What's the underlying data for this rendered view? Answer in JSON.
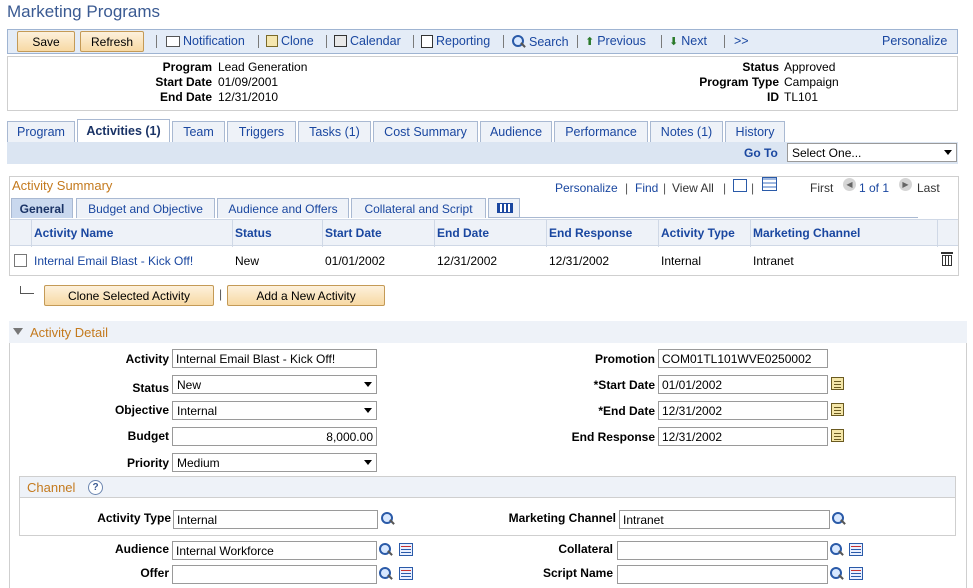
{
  "page_title": "Marketing Programs",
  "toolbar": {
    "save": "Save",
    "refresh": "Refresh",
    "notification": "Notification",
    "clone": "Clone",
    "calendar": "Calendar",
    "reporting": "Reporting",
    "search": "Search",
    "previous": "Previous",
    "next": "Next",
    "more": ">>",
    "personalize": "Personalize"
  },
  "header": {
    "program_label": "Program",
    "program": "Lead Generation",
    "start_date_label": "Start Date",
    "start_date": "01/09/2001",
    "end_date_label": "End Date",
    "end_date": "12/31/2010",
    "status_label": "Status",
    "status": "Approved",
    "program_type_label": "Program Type",
    "program_type": "Campaign",
    "id_label": "ID",
    "id": "TL101"
  },
  "tabs": [
    "Program",
    "Activities (1)",
    "Team",
    "Triggers",
    "Tasks (1)",
    "Cost Summary",
    "Audience",
    "Performance",
    "Notes (1)",
    "History"
  ],
  "goto": {
    "label": "Go To",
    "value": "Select One..."
  },
  "summary": {
    "title": "Activity Summary",
    "personalize": "Personalize",
    "find": "Find",
    "view_all": "View All",
    "first": "First",
    "range": "1 of 1",
    "last": "Last",
    "subtabs": [
      "General",
      "Budget and Objective",
      "Audience and Offers",
      "Collateral and Script"
    ],
    "columns": [
      "Activity Name",
      "Status",
      "Start Date",
      "End Date",
      "End Response",
      "Activity Type",
      "Marketing Channel"
    ],
    "rows": [
      [
        "Internal Email Blast - Kick Off!",
        "New",
        "01/01/2002",
        "12/31/2002",
        "12/31/2002",
        "Internal",
        "Intranet"
      ]
    ],
    "clone_button": "Clone Selected Activity",
    "add_button": "Add a New Activity"
  },
  "detail": {
    "title": "Activity Detail",
    "activity_label": "Activity",
    "activity": "Internal Email Blast - Kick Off!",
    "status_label": "Status",
    "status": "New",
    "objective_label": "Objective",
    "objective": "Internal",
    "budget_label": "Budget",
    "budget": "8,000.00",
    "priority_label": "Priority",
    "priority": "Medium",
    "promotion_label": "Promotion",
    "promotion": "COM01TL101WVE0250002",
    "start_date_label": "*Start Date",
    "start_date": "01/01/2002",
    "end_date_label": "*End Date",
    "end_date": "12/31/2002",
    "end_response_label": "End Response",
    "end_response": "12/31/2002"
  },
  "channel": {
    "title": "Channel",
    "help": "?",
    "activity_type_label": "Activity Type",
    "activity_type": "Internal",
    "marketing_channel_label": "Marketing Channel",
    "marketing_channel": "Intranet"
  },
  "bottom": {
    "audience_label": "Audience",
    "audience": "Internal Workforce",
    "offer_label": "Offer",
    "offer": "",
    "collateral_label": "Collateral",
    "collateral": "",
    "script_name_label": "Script Name",
    "script_name": ""
  }
}
